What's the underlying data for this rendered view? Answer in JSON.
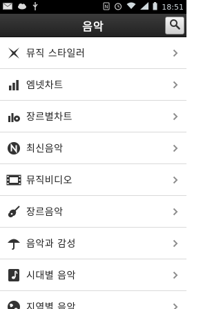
{
  "status_bar": {
    "time": "18:51"
  },
  "header": {
    "title": "음악"
  },
  "menu": {
    "items": [
      {
        "label": "뮤직 스타일러",
        "icon": "styler-icon"
      },
      {
        "label": "엠넷차트",
        "icon": "bar-chart-icon"
      },
      {
        "label": "장르별차트",
        "icon": "genre-chart-icon"
      },
      {
        "label": "최신음악",
        "icon": "new-music-icon"
      },
      {
        "label": "뮤직비디오",
        "icon": "film-icon"
      },
      {
        "label": "장르음악",
        "icon": "guitar-icon"
      },
      {
        "label": "음악과 감성",
        "icon": "umbrella-icon"
      },
      {
        "label": "시대별 음악",
        "icon": "music-note-icon"
      },
      {
        "label": "지역별 음악",
        "icon": "globe-icon"
      }
    ]
  },
  "colors": {
    "header_bg": "#2a2a2a",
    "icon": "#333333",
    "chevron": "#8c8c8c",
    "divider": "#d9d9d9"
  }
}
